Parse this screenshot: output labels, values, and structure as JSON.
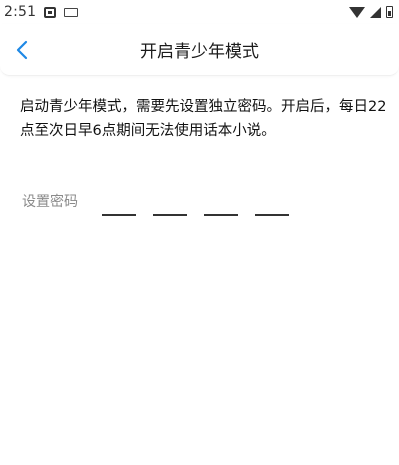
{
  "status_bar": {
    "time": "2:51"
  },
  "header": {
    "title": "开启青少年模式"
  },
  "main": {
    "description": "启动青少年模式，需要先设置独立密码。开启后，每日22点至次日早6点期间无法使用话本小说。",
    "password_label": "设置密码",
    "digit_count": 4
  },
  "colors": {
    "accent": "#1e88e5",
    "text": "#111111",
    "placeholder": "#8a8a8a"
  },
  "icons": {
    "back": "chevron-left-icon",
    "wifi": "wifi-icon",
    "signal": "signal-icon",
    "battery": "battery-icon"
  }
}
